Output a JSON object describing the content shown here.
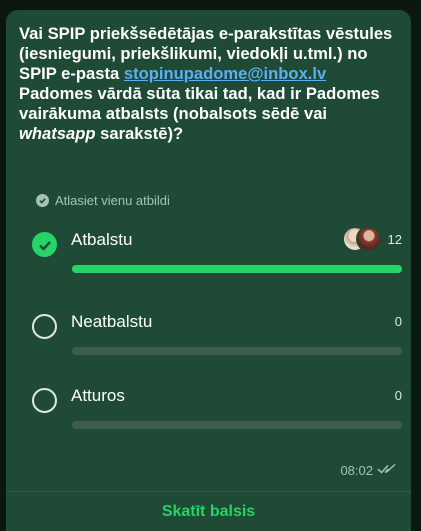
{
  "poll": {
    "question_part1": "Vai SPIP priekšsēdētājas e-parakstītas vēstules (iesniegumi, priekšlikumi, viedokļi u.tml.) no SPIP e-pasta ",
    "question_email": "stopinupadome@inbox.lv",
    "question_part2": " Padomes vārdā sūta tikai tad, kad ir Padomes vairākuma atbalsts (nobalsots sēdē vai ",
    "question_italic": "whatsapp",
    "question_part3": " sarakstē)?",
    "hint": "Atlasiet vienu atbildi",
    "options": [
      {
        "label": "Atbalstu",
        "count": "12",
        "fill": 1.0,
        "selected": true
      },
      {
        "label": "Neatbalstu",
        "count": "0",
        "fill": 0.0,
        "selected": false
      },
      {
        "label": "Atturos",
        "count": "0",
        "fill": 0.0,
        "selected": false
      }
    ],
    "time": "08:02",
    "read_icon": "double-check-icon",
    "view_votes": "Skatīt balsis"
  },
  "colors": {
    "bubble": "#1f4a35",
    "accent": "#25d366",
    "link": "#5ab0f5"
  }
}
